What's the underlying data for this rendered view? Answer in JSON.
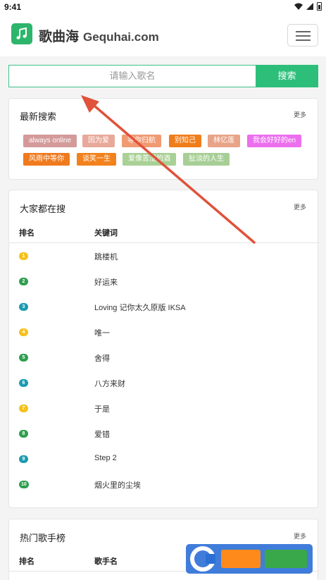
{
  "status_bar": {
    "time": "9:41"
  },
  "header": {
    "brand": "歌曲海",
    "domain": "Gequhai.com"
  },
  "search": {
    "placeholder": "请输入歌名",
    "button_label": "搜索"
  },
  "recent": {
    "title": "最新搜索",
    "more": "更多",
    "tags": [
      {
        "label": "always online",
        "color": "#d49a9a"
      },
      {
        "label": "因为爱",
        "color": "#e8a99a"
      },
      {
        "label": "等你归航",
        "color": "#f19a72"
      },
      {
        "label": "别知己",
        "color": "#f07d1c"
      },
      {
        "label": "林亿莲",
        "color": "#e8a487"
      },
      {
        "label": "我会好好的en",
        "color": "#ec6fee"
      },
      {
        "label": "风雨中等你",
        "color": "#f07a1e"
      },
      {
        "label": "谈笑一生",
        "color": "#f2821d"
      },
      {
        "label": "爱像苦涩的酒",
        "color": "#a9d095"
      },
      {
        "label": "扯淡的人生",
        "color": "#a7cf95"
      }
    ]
  },
  "popular": {
    "title": "大家都在搜",
    "more": "更多",
    "col_rank": "排名",
    "col_keyword": "关键词",
    "rows": [
      {
        "rank": "1",
        "keyword": "跳楼机",
        "color": "#f5c21a"
      },
      {
        "rank": "2",
        "keyword": "好运来",
        "color": "#2f9f4f"
      },
      {
        "rank": "3",
        "keyword": "Loving 记你太久原版 IKSA",
        "color": "#1c9bb0"
      },
      {
        "rank": "4",
        "keyword": "唯一",
        "color": "#f5c21a"
      },
      {
        "rank": "5",
        "keyword": "舍得",
        "color": "#2f9f4f"
      },
      {
        "rank": "6",
        "keyword": "八方来财",
        "color": "#1c9bb0"
      },
      {
        "rank": "7",
        "keyword": "于是",
        "color": "#f5c21a"
      },
      {
        "rank": "8",
        "keyword": "爱错",
        "color": "#2f9f4f"
      },
      {
        "rank": "9",
        "keyword": "Step 2",
        "color": "#1c9bb0"
      },
      {
        "rank": "10",
        "keyword": "烟火里的尘埃",
        "color": "#2f9f4f"
      }
    ]
  },
  "singers": {
    "title": "热门歌手榜",
    "more": "更多",
    "col_rank": "排名",
    "col_name": "歌手名"
  },
  "accent_color": "#2dbf7a"
}
